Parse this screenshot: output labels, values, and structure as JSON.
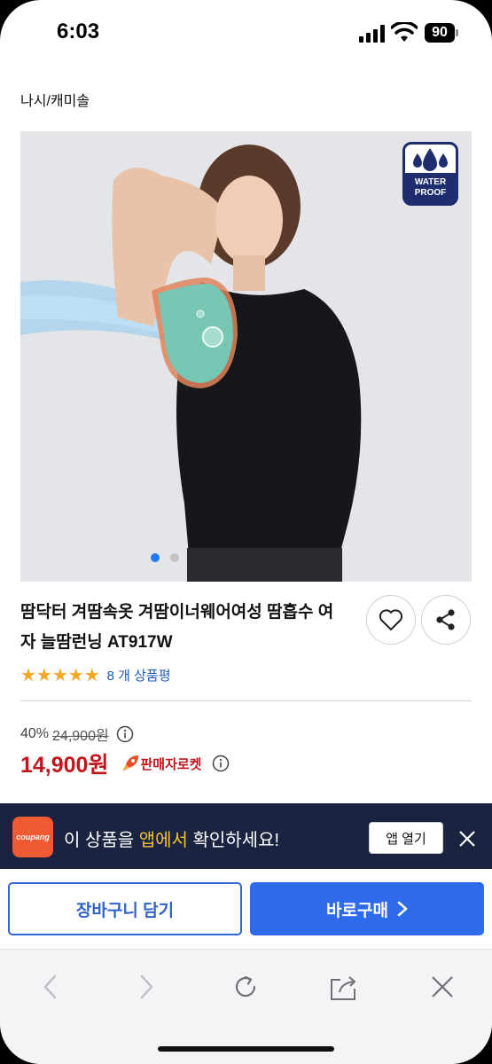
{
  "status_bar": {
    "time": "6:03",
    "battery": "90"
  },
  "breadcrumb": "나시/캐미솔",
  "hero": {
    "badge_line1": "WATER",
    "badge_line2": "PROOF",
    "slide_count": 2,
    "active_slide": 1
  },
  "product": {
    "title": "땀닥터 겨땀속옷 겨땀이너웨어여성 땀흡수 여자 늘땀런닝 AT917W",
    "rating_stars": "★★★★★",
    "review_count_text": "8 개 상품평",
    "discount": "40%",
    "original_price": "24,900원",
    "price": "14,900원",
    "delivery_badge": "판매자로켓"
  },
  "banner": {
    "logo_text": "coupang",
    "text_before": "이 상품을 ",
    "text_highlight": "앱에서",
    "text_after": " 확인하세요!",
    "open_app": "앱 열기"
  },
  "actions": {
    "cart": "장바구니 담기",
    "buy": "바로구매"
  },
  "colors": {
    "primary": "#2d6bea",
    "price": "#c4141c",
    "banner_bg": "#1a2340",
    "highlight": "#f7c12b"
  },
  "icons": [
    "heart-icon",
    "share-icon",
    "info-icon",
    "rocket-icon",
    "close-icon",
    "back-icon",
    "forward-icon",
    "reload-icon",
    "share-out-icon"
  ]
}
